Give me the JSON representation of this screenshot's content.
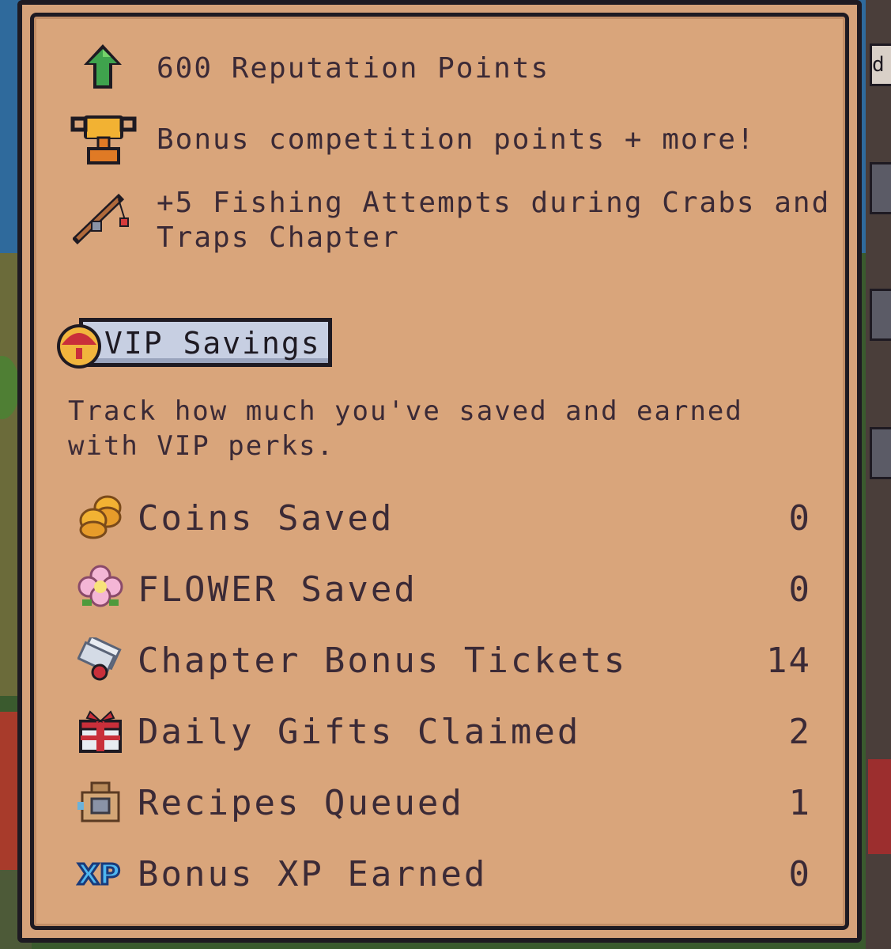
{
  "perks": [
    {
      "icon": "green-up-arrow-icon",
      "text": "600 Reputation Points"
    },
    {
      "icon": "gold-trophy-icon",
      "text": "Bonus competition points + more!"
    },
    {
      "icon": "fishing-rod-icon",
      "lines": [
        "+5 Fishing Attempts during Crabs and",
        "Traps Chapter"
      ]
    }
  ],
  "vip_savings": {
    "title": "VIP Savings",
    "icon": "vip-gift-icon",
    "description_lines": [
      "Track how much you've saved and earned",
      "with VIP perks."
    ]
  },
  "stats": [
    {
      "icon": "coins-icon",
      "label": "Coins Saved",
      "value": "0"
    },
    {
      "icon": "flower-icon",
      "label": "FLOWER Saved",
      "value": "0"
    },
    {
      "icon": "ticket-icon",
      "label": "Chapter Bonus Tickets",
      "value": "14"
    },
    {
      "icon": "gift-box-icon",
      "label": "Daily Gifts Claimed",
      "value": "2"
    },
    {
      "icon": "recipe-machine-icon",
      "label": "Recipes Queued",
      "value": "1"
    },
    {
      "icon": "xp-icon",
      "label": "Bonus XP Earned",
      "value": "0"
    }
  ],
  "right_tab_letter": "d",
  "colors": {
    "panel": "#d9a57b",
    "border": "#1e1a22",
    "text": "#3b2a36",
    "badge": "#c7cfe2"
  }
}
